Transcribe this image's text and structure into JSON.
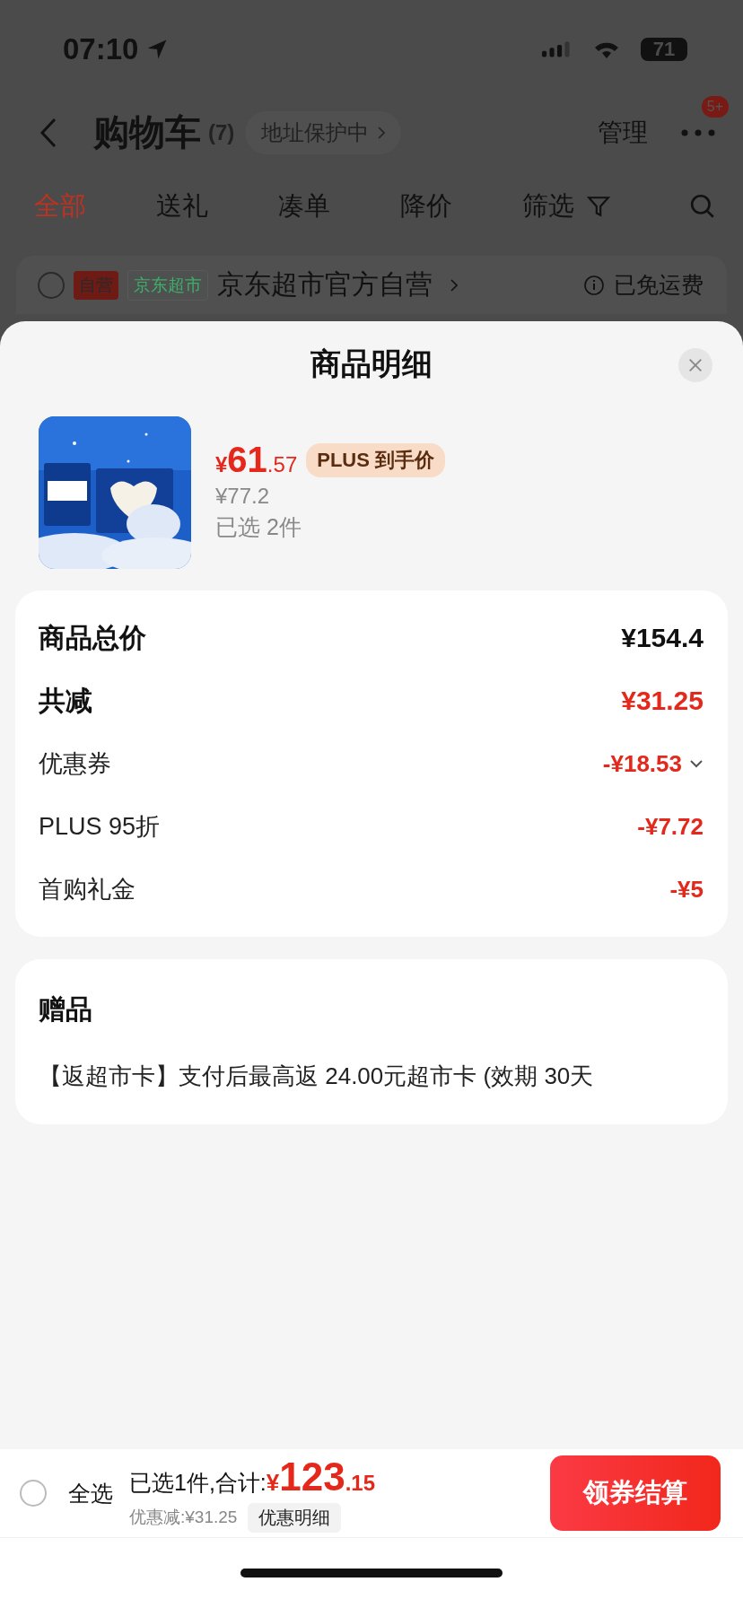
{
  "status_bar": {
    "time": "07:10",
    "battery": "71"
  },
  "nav": {
    "title": "购物车",
    "count": "(7)",
    "address_chip": "地址保护中",
    "manage": "管理",
    "badge": "5+"
  },
  "tabs": [
    {
      "label": "全部",
      "selected": true,
      "kind": "text"
    },
    {
      "label": "送礼",
      "selected": false,
      "kind": "text"
    },
    {
      "label": "凑单",
      "selected": false,
      "kind": "text"
    },
    {
      "label": "降价",
      "selected": false,
      "kind": "text"
    },
    {
      "label": "筛选",
      "selected": false,
      "kind": "filter"
    }
  ],
  "store": {
    "checked": false,
    "tags": [
      {
        "label": "自营",
        "kind": "self"
      },
      {
        "label": "京东超市",
        "kind": "market"
      }
    ],
    "name": "京东超市官方自营",
    "shipping": "已免运费"
  },
  "sheet": {
    "title": "商品明细",
    "product": {
      "kind": "picture",
      "currency": "¥",
      "price_int": "61",
      "price_dec": ".57",
      "badge": "PLUS 到手价",
      "original_price": "¥77.2",
      "quantity": "已选 2件"
    },
    "summary": [
      {
        "label": "商品总价",
        "value": "¥154.4",
        "kind": "total",
        "expandable": false
      },
      {
        "label": "共减",
        "value": "¥31.25",
        "kind": "reduction",
        "expandable": false
      },
      {
        "label": "优惠券",
        "value": "-¥18.53",
        "kind": "discount",
        "expandable": true
      },
      {
        "label": "PLUS 95折",
        "value": "-¥7.72",
        "kind": "discount",
        "expandable": false
      },
      {
        "label": "首购礼金",
        "value": "-¥5",
        "kind": "discount",
        "expandable": false
      }
    ],
    "gift": {
      "title": "赠品",
      "text": "【返超市卡】支付后最高返 24.00元超市卡 (效期 30天"
    }
  },
  "bottom_bar": {
    "select_all": {
      "label": "全选",
      "checked": false
    },
    "summary": "已选1件,合计:",
    "currency": "¥",
    "total_int": "123",
    "total_dec": ".15",
    "discount": "优惠减:¥31.25",
    "detail_button": "优惠明细",
    "checkout": "领券结算"
  }
}
